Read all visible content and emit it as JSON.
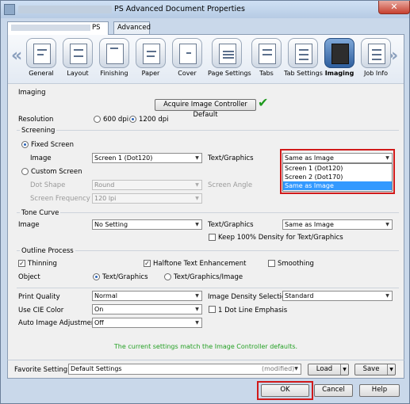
{
  "window": {
    "title": "PS Advanced Document Properties",
    "close_label": "✕"
  },
  "tabs": [
    {
      "label": "PS"
    },
    {
      "label": "Advanced"
    }
  ],
  "categories": [
    {
      "label": "General"
    },
    {
      "label": "Layout"
    },
    {
      "label": "Finishing"
    },
    {
      "label": "Paper"
    },
    {
      "label": "Cover"
    },
    {
      "label": "Page Settings"
    },
    {
      "label": "Tabs"
    },
    {
      "label": "Tab Settings"
    },
    {
      "label": "Imaging"
    },
    {
      "label": "Job Info"
    }
  ],
  "nav": {
    "prev": "«",
    "next": "»"
  },
  "imaging": {
    "section": "Imaging",
    "acquire_button": "Acquire Image Controller Default",
    "check_mark": "✔",
    "resolution_label": "Resolution",
    "res_600": "600 dpi",
    "res_1200": "1200 dpi"
  },
  "screening": {
    "section": "Screening",
    "fixed_screen": "Fixed Screen",
    "image_label": "Image",
    "image_value": "Screen 1 (Dot120)",
    "text_graphics_label": "Text/Graphics",
    "text_graphics_value": "Same as Image",
    "dropdown_options": [
      "Screen 1 (Dot120)",
      "Screen 2 (Dot170)",
      "Same as Image"
    ],
    "custom_screen": "Custom Screen",
    "dot_shape_label": "Dot Shape",
    "dot_shape_value": "Round",
    "screen_angle_label": "Screen Angle",
    "screen_frequency_label": "Screen Frequency",
    "screen_frequency_value": "120 lpi"
  },
  "tone_curve": {
    "section": "Tone Curve",
    "image_label": "Image",
    "image_value": "No Setting",
    "text_graphics_label": "Text/Graphics",
    "text_graphics_value": "Same as Image",
    "keep_density": "Keep 100% Density for Text/Graphics"
  },
  "outline_process": {
    "section": "Outline Process",
    "thinning": "Thinning",
    "halftone": "Halftone Text Enhancement",
    "smoothing": "Smoothing",
    "object_label": "Object",
    "obj_text_graphics": "Text/Graphics",
    "obj_text_graphics_image": "Text/Graphics/Image"
  },
  "misc": {
    "print_quality_label": "Print Quality",
    "print_quality_value": "Normal",
    "image_density_label": "Image Density Selection",
    "image_density_value": "Standard",
    "use_cie_label": "Use CIE Color",
    "use_cie_value": "On",
    "dot_line_emphasis": "1 Dot Line Emphasis",
    "auto_adjust_label": "Auto Image Adjustment",
    "auto_adjust_value": "Off",
    "status_message": "The current settings match the Image Controller defaults."
  },
  "favorite": {
    "label": "Favorite Setting",
    "value": "Default Settings",
    "modified": "(modified)",
    "load": "Load",
    "save": "Save"
  },
  "dialog_buttons": {
    "ok": "OK",
    "cancel": "Cancel",
    "help": "Help"
  },
  "colors": {
    "highlight": "#d11a1a",
    "status_green": "#24a024",
    "selection": "#3399ff"
  }
}
